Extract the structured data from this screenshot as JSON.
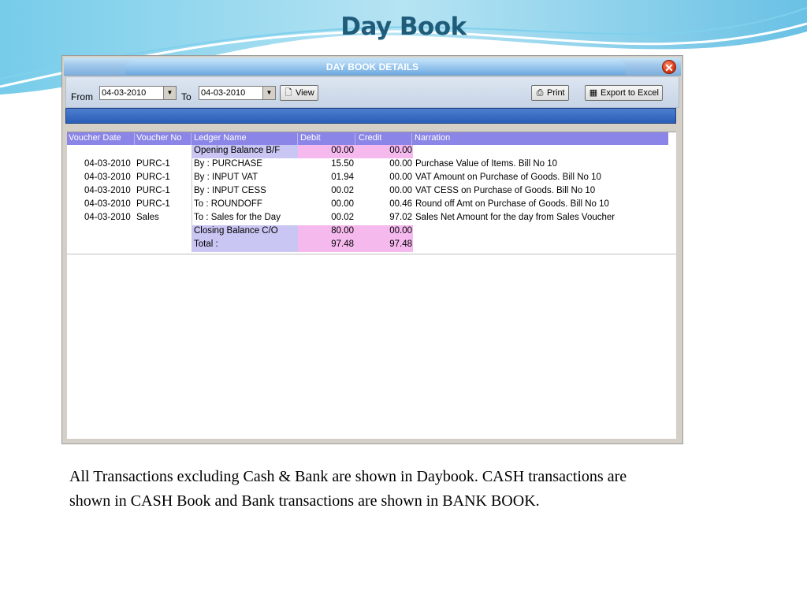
{
  "slide": {
    "title": "Day Book",
    "caption": "All Transactions excluding Cash & Bank are shown in Daybook. CASH transactions are shown in CASH Book and Bank transactions are shown in BANK BOOK."
  },
  "window": {
    "title": "DAY BOOK DETAILS",
    "close_icon": "close-icon"
  },
  "toolbar": {
    "from_label": "From",
    "from_value": "04-03-2010",
    "to_label": "To",
    "to_value": "04-03-2010",
    "view_label": "View",
    "print_label": "Print",
    "export_label": "Export to Excel"
  },
  "grid": {
    "columns": [
      "Voucher Date",
      "Voucher No",
      "Ledger Name",
      "Debit",
      "Credit",
      "Narration"
    ],
    "rows": [
      {
        "date": "",
        "vno": "",
        "ledger": "Opening Balance B/F",
        "debit": "00.00",
        "credit": "00.00",
        "narration": ""
      },
      {
        "date": "04-03-2010",
        "vno": "PURC-1",
        "ledger": "By : PURCHASE",
        "debit": "15.50",
        "credit": "00.00",
        "narration": "Purchase Value of Items. Bill No 10"
      },
      {
        "date": "04-03-2010",
        "vno": "PURC-1",
        "ledger": "By : INPUT VAT",
        "debit": "01.94",
        "credit": "00.00",
        "narration": "VAT Amount on Purchase of Goods. Bill No 10"
      },
      {
        "date": "04-03-2010",
        "vno": "PURC-1",
        "ledger": "By : INPUT CESS",
        "debit": "00.02",
        "credit": "00.00",
        "narration": "VAT CESS on Purchase of Goods. Bill No 10"
      },
      {
        "date": "04-03-2010",
        "vno": "PURC-1",
        "ledger": "To : ROUNDOFF",
        "debit": "00.00",
        "credit": "00.46",
        "narration": "Round off Amt on Purchase of Goods. Bill No 10"
      },
      {
        "date": "04-03-2010",
        "vno": "Sales",
        "ledger": "To : Sales for the Day",
        "debit": "00.02",
        "credit": "97.02",
        "narration": "Sales Net Amount for the day from Sales Voucher"
      },
      {
        "date": "",
        "vno": "",
        "ledger": "Closing Balance C/O",
        "debit": "80.00",
        "credit": "00.00",
        "narration": ""
      },
      {
        "date": "",
        "vno": "",
        "ledger": "Total :",
        "debit": "97.48",
        "credit": "97.48",
        "narration": ""
      }
    ]
  },
  "colors": {
    "header_bg": "#8a85e6",
    "ledger_highlight": "#c9c6f3",
    "amount_highlight": "#f5b9ee",
    "title_color": "#1f5c7a"
  }
}
